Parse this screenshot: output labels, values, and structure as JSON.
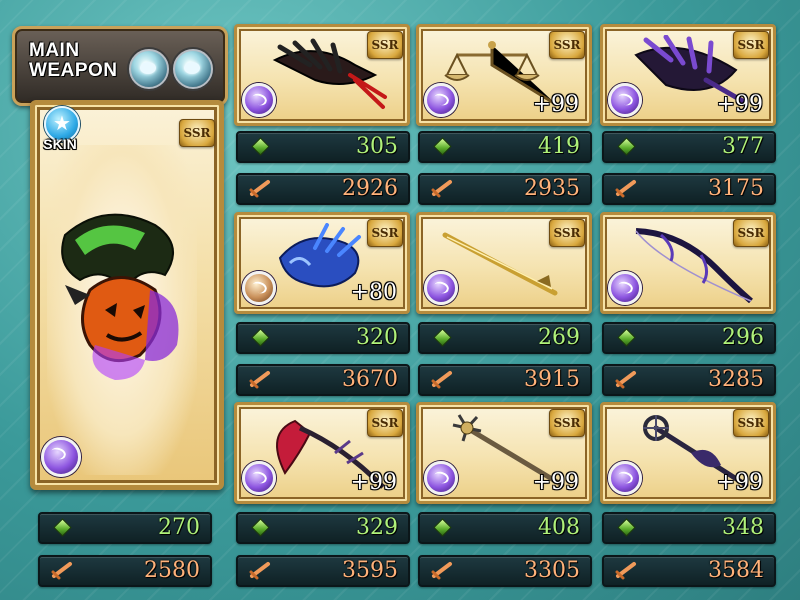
{
  "main": {
    "title_line1": "MAIN",
    "title_line2": "WEAPON",
    "skin_label": "SKIN",
    "rarity": "SSR",
    "element": "dark",
    "hp": "270",
    "atk": "2580"
  },
  "grid": {
    "weapons": [
      {
        "name": "claw",
        "rarity": "SSR",
        "element": "dark",
        "plus": "",
        "hp": "305",
        "atk": "2926"
      },
      {
        "name": "scales",
        "rarity": "SSR",
        "element": "dark",
        "plus": "+99",
        "hp": "419",
        "atk": "2935"
      },
      {
        "name": "dark-claw",
        "rarity": "SSR",
        "element": "dark",
        "plus": "+99",
        "hp": "377",
        "atk": "3175"
      },
      {
        "name": "blue-gauntlet",
        "rarity": "SSR",
        "element": "fire",
        "plus": "+80",
        "hp": "320",
        "atk": "3670"
      },
      {
        "name": "golden-katana",
        "rarity": "SSR",
        "element": "dark",
        "plus": "",
        "hp": "269",
        "atk": "3915"
      },
      {
        "name": "dark-bow",
        "rarity": "SSR",
        "element": "dark",
        "plus": "",
        "hp": "296",
        "atk": "3285"
      },
      {
        "name": "red-scythe",
        "rarity": "SSR",
        "element": "dark",
        "plus": "+99",
        "hp": "329",
        "atk": "3595"
      },
      {
        "name": "star-spear",
        "rarity": "SSR",
        "element": "dark",
        "plus": "+99",
        "hp": "408",
        "atk": "3305"
      },
      {
        "name": "dark-staff",
        "rarity": "SSR",
        "element": "dark",
        "plus": "+99",
        "hp": "348",
        "atk": "3584"
      }
    ]
  },
  "icons": {
    "hp": "green-diamond-hp-icon",
    "atk": "orange-sword-atk-icon",
    "dark_element": "purple-dark-element-icon",
    "fire_element": "bronze-element-icon"
  },
  "colors": {
    "hp_text": "#aff27a",
    "atk_text": "#ffb27a",
    "background": "#3b9a9a",
    "frame_gold": "#b58b3d"
  }
}
